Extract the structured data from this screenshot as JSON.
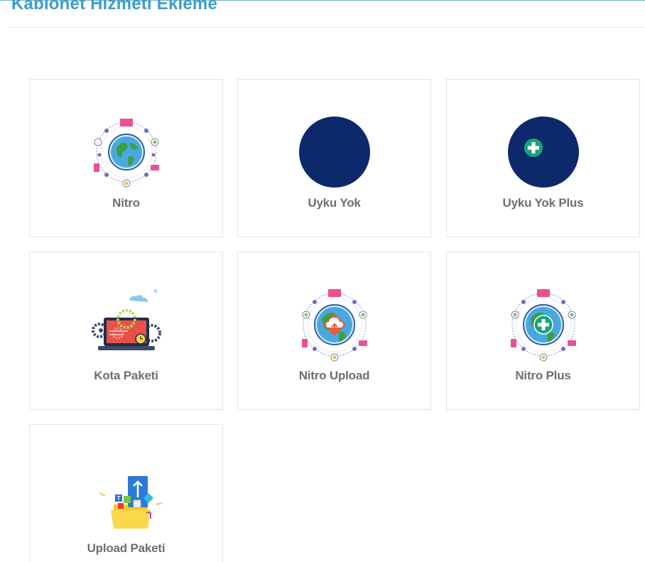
{
  "page": {
    "title": "Kablonet Hizmeti Ekleme"
  },
  "services": [
    {
      "label": "Nitro",
      "icon": "globe-network-icon"
    },
    {
      "label": "Uyku Yok",
      "icon": "moon-icon"
    },
    {
      "label": "Uyku Yok Plus",
      "icon": "moon-plus-icon"
    },
    {
      "label": "Kota Paketi",
      "icon": "laptop-gears-icon"
    },
    {
      "label": "Nitro Upload",
      "icon": "globe-upload-icon"
    },
    {
      "label": "Nitro Plus",
      "icon": "globe-plus-icon"
    },
    {
      "label": "Upload Paketi",
      "icon": "folder-upload-icon"
    }
  ],
  "colors": {
    "title": "#3f9ccb",
    "moon_bg": "#0c2a6b",
    "plus_green": "#1aa37a",
    "label": "#6e6e6e"
  }
}
